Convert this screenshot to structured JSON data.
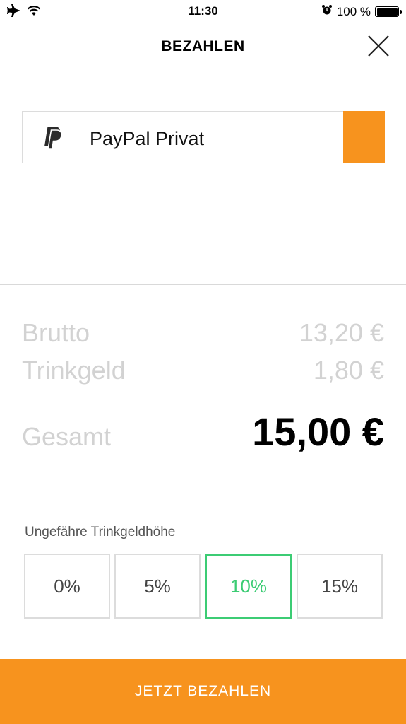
{
  "status_bar": {
    "time": "11:30",
    "battery": "100 %",
    "icons": [
      "airplane-icon",
      "wifi-icon",
      "alarm-icon",
      "battery-icon"
    ]
  },
  "header": {
    "title": "BEZAHLEN",
    "close_icon": "close-icon"
  },
  "payment_method": {
    "label": "PayPal Privat",
    "icon": "paypal-icon"
  },
  "summary": {
    "brutto_label": "Brutto",
    "brutto_value": "13,20 €",
    "tip_label": "Trinkgeld",
    "tip_value": "1,80 €",
    "total_label": "Gesamt",
    "total_value": "15,00 €"
  },
  "tip": {
    "caption": "Ungefähre Trinkgeldhöhe",
    "options": [
      "0%",
      "5%",
      "10%",
      "15%"
    ],
    "selected": "10%"
  },
  "pay_button": {
    "label": "JETZT BEZAHLEN"
  },
  "colors": {
    "accent_orange": "#f7931e",
    "selected_green": "#3ccc74",
    "muted_text": "#d2d2d2"
  }
}
